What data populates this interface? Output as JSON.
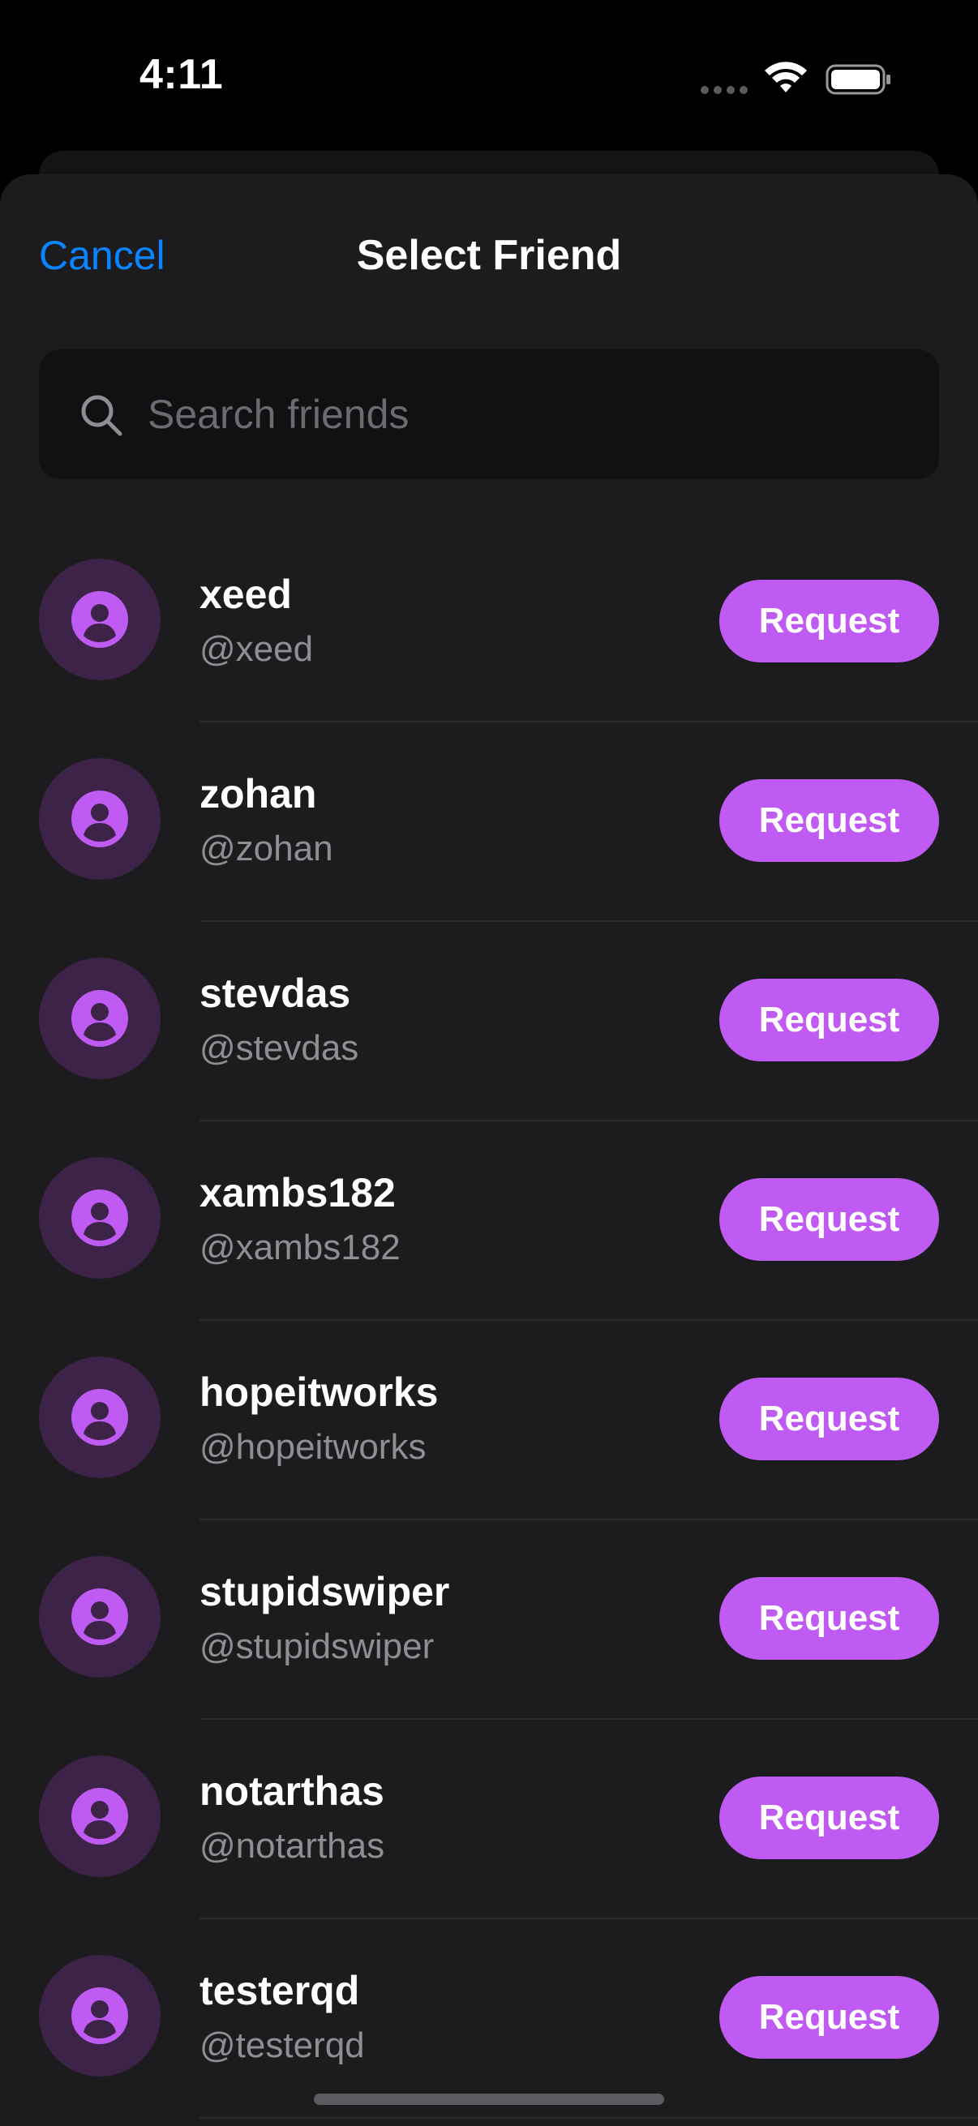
{
  "status_bar": {
    "time": "4:11",
    "icons": [
      "signal-dots-icon",
      "wifi-icon",
      "battery-icon"
    ]
  },
  "sheet": {
    "cancel_label": "Cancel",
    "title": "Select Friend"
  },
  "search": {
    "placeholder": "Search friends",
    "value": "",
    "icon": "search-icon"
  },
  "friends": [
    {
      "name": "xeed",
      "handle": "@xeed",
      "action": "Request"
    },
    {
      "name": "zohan",
      "handle": "@zohan",
      "action": "Request"
    },
    {
      "name": "stevdas",
      "handle": "@stevdas",
      "action": "Request"
    },
    {
      "name": "xambs182",
      "handle": "@xambs182",
      "action": "Request"
    },
    {
      "name": "hopeitworks",
      "handle": "@hopeitworks",
      "action": "Request"
    },
    {
      "name": "stupidswiper",
      "handle": "@stupidswiper",
      "action": "Request"
    },
    {
      "name": "notarthas",
      "handle": "@notarthas",
      "action": "Request"
    },
    {
      "name": "testerqd",
      "handle": "@testerqd",
      "action": "Request"
    }
  ],
  "colors": {
    "background": "#000000",
    "sheet": "#1c1c1e",
    "search_field": "#111113",
    "accent_link": "#0a84ff",
    "request_button": "#bf5af2",
    "avatar_bg": "#3d2347",
    "avatar_icon": "#bf5af2",
    "secondary_text": "#8e8e93"
  }
}
